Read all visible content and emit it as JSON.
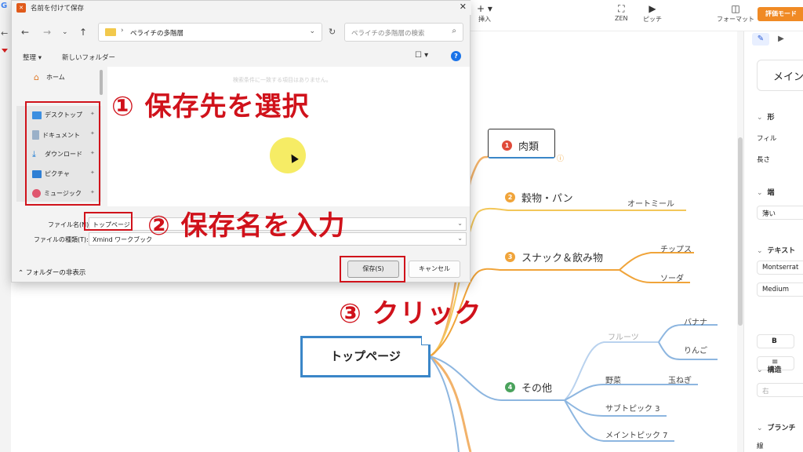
{
  "toolbar": {
    "insert_label": "挿入",
    "zen_label": "ZEN",
    "pitch_label": "ピッチ",
    "format_label": "フォーマット",
    "eval_mode_label": "評価モード",
    "insert_icon": "plus-icon",
    "zen_icon": "fullscreen-icon",
    "pitch_icon": "play-icon",
    "format_icon": "panel-icon"
  },
  "right_panel": {
    "style_tab_icon": "brush-icon",
    "pitch_tab_icon": "play-icon",
    "main_style_label": "メイン",
    "shape_section": "形",
    "fill_label": "フィル",
    "length_label": "長さ",
    "edge_section": "端",
    "edge_value": "薄い",
    "text_section": "テキスト",
    "font_value": "Montserrat",
    "weight_value": "Medium",
    "bold_label": "B",
    "structure_section": "構造",
    "structure_value": "右",
    "branch_section": "ブランチ",
    "line_label": "線"
  },
  "mindmap": {
    "root": "トップページ",
    "topics": [
      {
        "number": "1",
        "label": "肉類",
        "color": "#e04b3a"
      },
      {
        "number": "2",
        "label": "穀物・パン",
        "color": "#f0a43a"
      },
      {
        "number": "3",
        "label": "スナック＆飲み物",
        "color": "#f0a43a"
      },
      {
        "number": "4",
        "label": "その他",
        "color": "#4aa25c"
      }
    ],
    "subtopics": {
      "grain": "オートミール",
      "snack_1": "チップス",
      "snack_2": "ソーダ",
      "fruit": "フルーツ",
      "banana": "バナナ",
      "apple": "りんご",
      "veg": "野菜",
      "onion": "玉ねぎ",
      "subtopic3": "サブトピック 3",
      "main7": "メイントピック 7"
    },
    "colors": {
      "root_border": "#3a86c8",
      "branch_orange": "#f0a43a",
      "branch_blue": "#8db6e0"
    }
  },
  "dialog": {
    "title": "名前を付けて保存",
    "close_icon": "close-icon",
    "breadcrumb": "ペライチの多階層",
    "search_placeholder": "ペライチの多階層の検索",
    "organize_label": "整理 ▾",
    "new_folder_label": "新しいフォルダー",
    "sidebar": {
      "home": "ホーム",
      "items": [
        {
          "label": "デスクトップ",
          "icon": "desktop-icon"
        },
        {
          "label": "ドキュメント",
          "icon": "document-icon"
        },
        {
          "label": "ダウンロード",
          "icon": "download-icon"
        },
        {
          "label": "ピクチャ",
          "icon": "picture-icon"
        },
        {
          "label": "ミュージック",
          "icon": "music-icon"
        }
      ]
    },
    "empty_message": "検索条件に一致する項目はありません。",
    "filename_label": "ファイル名(N):",
    "filename_value": "トップページ",
    "filetype_label": "ファイルの種類(T):",
    "filetype_value": "Xmind ワークブック",
    "hide_folders_label": "フォルダーの非表示",
    "save_label": "保存(S)",
    "cancel_label": "キャンセル"
  },
  "annotations": {
    "step1": "① 保存先を選択",
    "step2": "② 保存名を入力",
    "step3": "③ クリック",
    "color": "#d0121b"
  }
}
